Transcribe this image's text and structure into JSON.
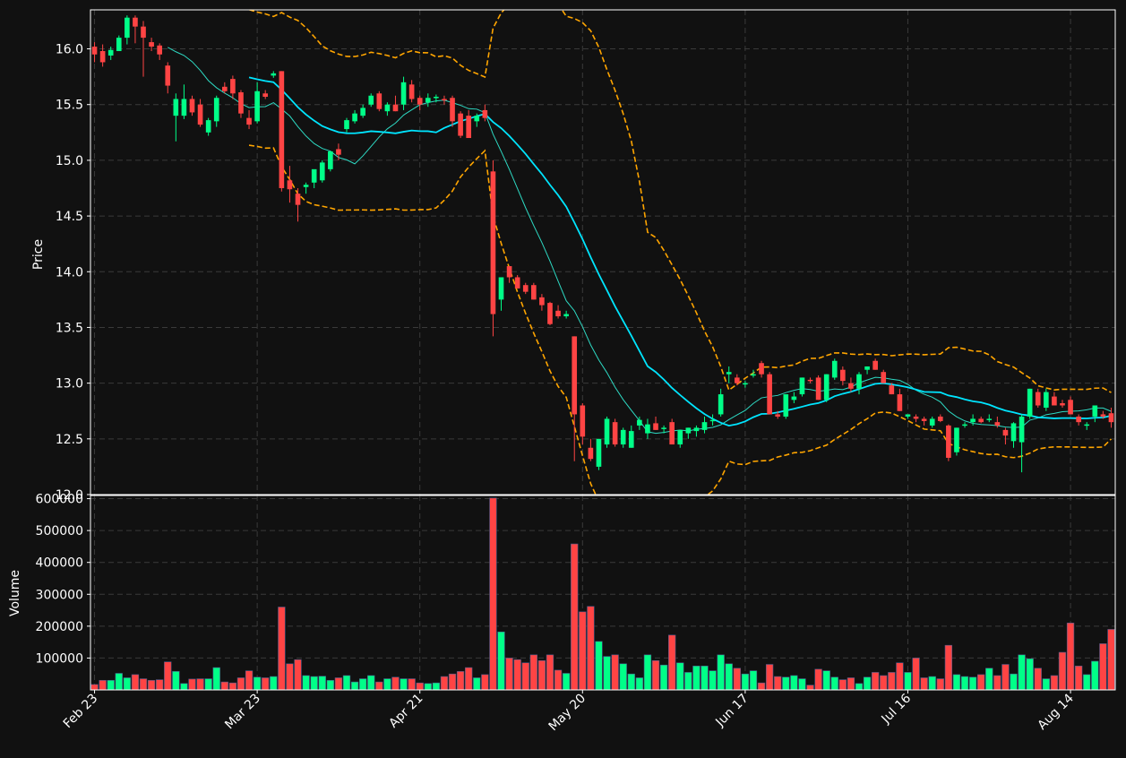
{
  "chart_data": [
    {
      "type": "candlestick",
      "ylabel": "Price",
      "ylim": [
        12.0,
        16.35
      ],
      "yticks": [
        "12.0",
        "12.5",
        "13.0",
        "13.5",
        "14.0",
        "14.5",
        "15.0",
        "15.5",
        "16.0"
      ],
      "xticks": [
        {
          "label": "Feb 23",
          "index": 0
        },
        {
          "label": "Mar 23",
          "index": 20
        },
        {
          "label": "Apr 21",
          "index": 40
        },
        {
          "label": "May 20",
          "index": 60
        },
        {
          "label": "Jun 17",
          "index": 80
        },
        {
          "label": "Jul 16",
          "index": 100
        },
        {
          "label": "Aug 14",
          "index": 120
        }
      ],
      "grid": true,
      "ohlc": [
        [
          16.02,
          16.06,
          15.88,
          15.95
        ],
        [
          15.98,
          16.04,
          15.84,
          15.88
        ],
        [
          15.94,
          16.02,
          15.9,
          15.99
        ],
        [
          15.98,
          16.12,
          15.98,
          16.1
        ],
        [
          16.1,
          16.3,
          16.04,
          16.28
        ],
        [
          16.28,
          16.3,
          16.05,
          16.2
        ],
        [
          16.2,
          16.25,
          15.75,
          16.1
        ],
        [
          16.06,
          16.1,
          15.98,
          16.02
        ],
        [
          16.03,
          16.05,
          15.9,
          15.95
        ],
        [
          15.85,
          15.88,
          15.6,
          15.67
        ],
        [
          15.4,
          15.6,
          15.17,
          15.55
        ],
        [
          15.4,
          15.68,
          15.37,
          15.55
        ],
        [
          15.55,
          15.58,
          15.4,
          15.43
        ],
        [
          15.5,
          15.55,
          15.3,
          15.32
        ],
        [
          15.25,
          15.38,
          15.22,
          15.36
        ],
        [
          15.35,
          15.58,
          15.3,
          15.56
        ],
        [
          15.66,
          15.7,
          15.6,
          15.62
        ],
        [
          15.73,
          15.76,
          15.55,
          15.6
        ],
        [
          15.61,
          15.63,
          15.38,
          15.42
        ],
        [
          15.38,
          15.45,
          15.28,
          15.32
        ],
        [
          15.35,
          15.7,
          15.33,
          15.62
        ],
        [
          15.6,
          15.63,
          15.55,
          15.57
        ],
        [
          15.76,
          15.8,
          15.74,
          15.78
        ],
        [
          15.8,
          15.8,
          14.72,
          14.75
        ],
        [
          14.82,
          14.95,
          14.62,
          14.74
        ],
        [
          14.7,
          14.75,
          14.45,
          14.6
        ],
        [
          14.76,
          14.8,
          14.7,
          14.78
        ],
        [
          14.8,
          14.9,
          14.75,
          14.92
        ],
        [
          14.82,
          15.0,
          14.8,
          14.98
        ],
        [
          14.92,
          15.08,
          14.9,
          15.08
        ],
        [
          15.1,
          15.15,
          15.0,
          15.05
        ],
        [
          15.28,
          15.38,
          15.25,
          15.36
        ],
        [
          15.35,
          15.45,
          15.33,
          15.42
        ],
        [
          15.4,
          15.5,
          15.38,
          15.47
        ],
        [
          15.5,
          15.6,
          15.48,
          15.58
        ],
        [
          15.6,
          15.62,
          15.44,
          15.46
        ],
        [
          15.44,
          15.52,
          15.4,
          15.5
        ],
        [
          15.5,
          15.58,
          15.44,
          15.44
        ],
        [
          15.5,
          15.75,
          15.45,
          15.7
        ],
        [
          15.68,
          15.72,
          15.52,
          15.55
        ],
        [
          15.56,
          15.58,
          15.45,
          15.5
        ],
        [
          15.52,
          15.6,
          15.48,
          15.56
        ],
        [
          15.56,
          15.59,
          15.52,
          15.57
        ],
        [
          15.55,
          15.58,
          15.5,
          15.54
        ],
        [
          15.56,
          15.58,
          15.3,
          15.35
        ],
        [
          15.42,
          15.44,
          15.2,
          15.22
        ],
        [
          15.4,
          15.45,
          15.2,
          15.2
        ],
        [
          15.35,
          15.42,
          15.3,
          15.4
        ],
        [
          15.45,
          15.5,
          15.35,
          15.38
        ],
        [
          14.9,
          15.0,
          13.42,
          13.62
        ],
        [
          13.75,
          13.95,
          13.65,
          13.95
        ],
        [
          14.05,
          14.05,
          13.9,
          13.95
        ],
        [
          13.95,
          13.97,
          13.85,
          13.85
        ],
        [
          13.88,
          13.9,
          13.8,
          13.82
        ],
        [
          13.88,
          13.9,
          13.75,
          13.75
        ],
        [
          13.77,
          13.8,
          13.65,
          13.7
        ],
        [
          13.72,
          13.73,
          13.52,
          13.53
        ],
        [
          13.65,
          13.7,
          13.58,
          13.6
        ],
        [
          13.6,
          13.65,
          13.58,
          13.62
        ],
        [
          13.42,
          13.42,
          12.3,
          12.72
        ],
        [
          12.8,
          12.82,
          12.45,
          12.52
        ],
        [
          12.42,
          12.5,
          12.3,
          12.32
        ],
        [
          12.25,
          12.5,
          12.22,
          12.5
        ],
        [
          12.45,
          12.7,
          12.42,
          12.68
        ],
        [
          12.65,
          12.68,
          12.43,
          12.45
        ],
        [
          12.45,
          12.6,
          12.42,
          12.58
        ],
        [
          12.42,
          12.62,
          12.42,
          12.57
        ],
        [
          12.62,
          12.7,
          12.58,
          12.67
        ],
        [
          12.55,
          12.68,
          12.5,
          12.63
        ],
        [
          12.64,
          12.7,
          12.58,
          12.58
        ],
        [
          12.6,
          12.62,
          12.55,
          12.6
        ],
        [
          12.65,
          12.68,
          12.45,
          12.45
        ],
        [
          12.45,
          12.58,
          12.42,
          12.58
        ],
        [
          12.55,
          12.6,
          12.5,
          12.6
        ],
        [
          12.57,
          12.62,
          12.52,
          12.6
        ],
        [
          12.58,
          12.7,
          12.55,
          12.65
        ],
        [
          12.66,
          12.72,
          12.62,
          12.67
        ],
        [
          12.72,
          12.95,
          12.7,
          12.9
        ],
        [
          13.08,
          13.15,
          13.0,
          13.1
        ],
        [
          13.05,
          13.08,
          12.98,
          13.0
        ],
        [
          13.0,
          13.02,
          12.96,
          13.0
        ],
        [
          13.08,
          13.12,
          13.05,
          13.08
        ],
        [
          13.18,
          13.2,
          13.05,
          13.08
        ],
        [
          13.08,
          13.1,
          12.72,
          12.72
        ],
        [
          12.72,
          12.75,
          12.68,
          12.7
        ],
        [
          12.7,
          12.9,
          12.68,
          12.9
        ],
        [
          12.85,
          12.92,
          12.82,
          12.88
        ],
        [
          12.9,
          13.05,
          12.88,
          13.05
        ],
        [
          13.03,
          13.05,
          13.0,
          13.02
        ],
        [
          13.05,
          13.07,
          12.85,
          12.85
        ],
        [
          12.85,
          13.08,
          12.83,
          13.08
        ],
        [
          13.05,
          13.22,
          13.03,
          13.2
        ],
        [
          13.12,
          13.15,
          12.98,
          13.02
        ],
        [
          13.0,
          13.05,
          12.92,
          12.95
        ],
        [
          12.95,
          13.1,
          12.9,
          13.08
        ],
        [
          13.12,
          13.15,
          13.08,
          13.15
        ],
        [
          13.2,
          13.22,
          13.12,
          13.12
        ],
        [
          13.1,
          13.12,
          13.0,
          13.0
        ],
        [
          12.98,
          13.0,
          12.9,
          12.9
        ],
        [
          12.9,
          12.95,
          12.75,
          12.75
        ],
        [
          12.7,
          12.72,
          12.68,
          12.72
        ],
        [
          12.7,
          12.72,
          12.65,
          12.68
        ],
        [
          12.68,
          12.7,
          12.62,
          12.66
        ],
        [
          12.62,
          12.7,
          12.6,
          12.68
        ],
        [
          12.7,
          12.72,
          12.65,
          12.66
        ],
        [
          12.62,
          12.63,
          12.3,
          12.33
        ],
        [
          12.38,
          12.6,
          12.35,
          12.6
        ],
        [
          12.62,
          12.65,
          12.6,
          12.63
        ],
        [
          12.65,
          12.72,
          12.62,
          12.68
        ],
        [
          12.68,
          12.7,
          12.64,
          12.65
        ],
        [
          12.68,
          12.72,
          12.65,
          12.68
        ],
        [
          12.65,
          12.7,
          12.6,
          12.62
        ],
        [
          12.58,
          12.6,
          12.45,
          12.53
        ],
        [
          12.48,
          12.65,
          12.42,
          12.64
        ],
        [
          12.47,
          12.72,
          12.2,
          12.7
        ],
        [
          12.7,
          12.95,
          12.68,
          12.95
        ],
        [
          12.92,
          12.95,
          12.78,
          12.8
        ],
        [
          12.78,
          12.95,
          12.75,
          12.92
        ],
        [
          12.88,
          12.92,
          12.8,
          12.8
        ],
        [
          12.82,
          12.85,
          12.78,
          12.8
        ],
        [
          12.85,
          12.88,
          12.72,
          12.72
        ],
        [
          12.7,
          12.72,
          12.62,
          12.65
        ],
        [
          12.62,
          12.65,
          12.58,
          12.63
        ],
        [
          12.7,
          12.8,
          12.65,
          12.8
        ],
        [
          12.72,
          12.75,
          12.68,
          12.7
        ],
        [
          12.73,
          12.78,
          12.6,
          12.65
        ]
      ],
      "moving_averages": [
        {
          "window": 10,
          "color": "#2ed9c3"
        },
        {
          "window": 20,
          "color": "#00e5ff"
        }
      ],
      "bollinger": {
        "window": 20,
        "std": 2,
        "color": "#ffa500"
      },
      "up_color": "#00ff88",
      "down_color": "#ff4444"
    },
    {
      "type": "bar",
      "ylabel": "Volume",
      "ylim": [
        0,
        610000
      ],
      "yticks": [
        "100000",
        "200000",
        "300000",
        "400000",
        "500000",
        "600000"
      ],
      "grid": true,
      "values": [
        17000,
        30000,
        30000,
        52000,
        38000,
        48000,
        35000,
        30000,
        32000,
        88000,
        58000,
        20000,
        34000,
        35000,
        35000,
        70000,
        25000,
        22000,
        38000,
        60000,
        40000,
        38000,
        42000,
        260000,
        82000,
        95000,
        45000,
        42000,
        43000,
        30000,
        38000,
        45000,
        25000,
        35000,
        45000,
        25000,
        35000,
        40000,
        35000,
        35000,
        22000,
        20000,
        22000,
        42000,
        50000,
        58000,
        70000,
        38000,
        48000,
        602000,
        182000,
        100000,
        95000,
        85000,
        110000,
        92000,
        110000,
        62000,
        52000,
        458000,
        245000,
        262000,
        152000,
        105000,
        110000,
        82000,
        50000,
        38000,
        110000,
        92000,
        78000,
        172000,
        85000,
        55000,
        75000,
        75000,
        60000,
        110000,
        82000,
        68000,
        50000,
        60000,
        22000,
        80000,
        42000,
        40000,
        45000,
        35000,
        15000,
        65000,
        60000,
        40000,
        32000,
        38000,
        20000,
        40000,
        55000,
        45000,
        55000,
        85000,
        55000,
        100000,
        38000,
        42000,
        35000,
        140000,
        48000,
        42000,
        40000,
        48000,
        68000,
        45000,
        80000,
        50000,
        110000,
        98000,
        68000,
        35000,
        45000,
        118000,
        210000,
        75000,
        48000,
        90000,
        145000,
        190000
      ]
    }
  ]
}
